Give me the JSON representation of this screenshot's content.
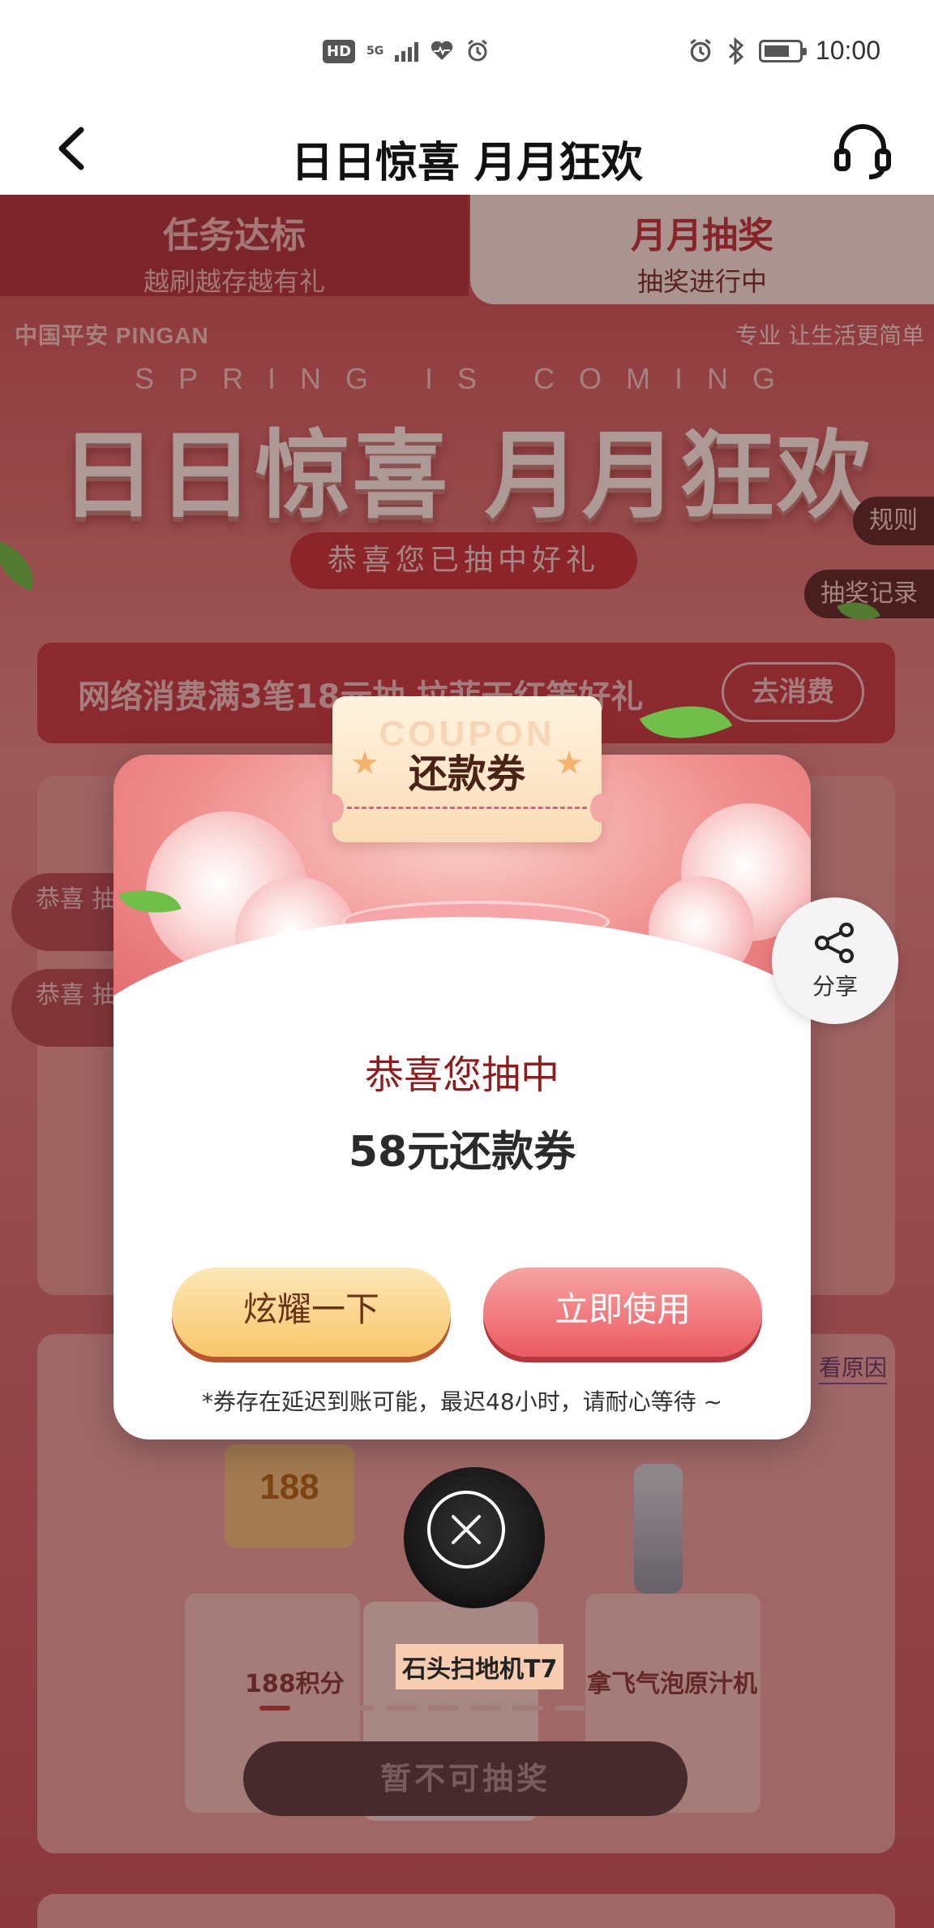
{
  "status_bar": {
    "time": "10:00",
    "network": "5G"
  },
  "nav": {
    "title": "日日惊喜 月月狂欢"
  },
  "tabs": [
    {
      "title": "任务达标",
      "subtitle": "越刷越存越有礼"
    },
    {
      "title": "月月抽奖",
      "subtitle": "抽奖进行中"
    }
  ],
  "banner": {
    "brand": "中国平安 PINGAN",
    "slogan": "专业 让生活更简单",
    "spring": "SPRING IS COMING",
    "title": "日日惊喜 月月狂欢",
    "pill": "恭喜您已抽中好礼"
  },
  "side_tags": {
    "rules": "规则",
    "records": "抽奖记录"
  },
  "promo": {
    "text": "网络消费满3笔18元抽 拉菲干红等好礼",
    "button": "去消费"
  },
  "tickers": [
    "恭喜 抽",
    "恭喜 抽中"
  ],
  "prizes": [
    {
      "label": "188积分",
      "value": "188"
    },
    {
      "label": "石头扫地机T7"
    },
    {
      "label": "拿飞气泡原汁机"
    }
  ],
  "view_reason": "看原因",
  "lottery_button": "暂不可抽奖",
  "modal": {
    "ticket_label": "还款券",
    "ticket_watermark": "COUPON",
    "congrats": "恭喜您抽中",
    "prize_name": "58元还款券",
    "show_button": "炫耀一下",
    "use_button": "立即使用",
    "note": "*券存在延迟到账可能，最迟48小时，请耐心等待 ~"
  },
  "share": {
    "label": "分享"
  },
  "colors": {
    "accent_red": "#c0343a",
    "gold": "#f8c66a"
  }
}
